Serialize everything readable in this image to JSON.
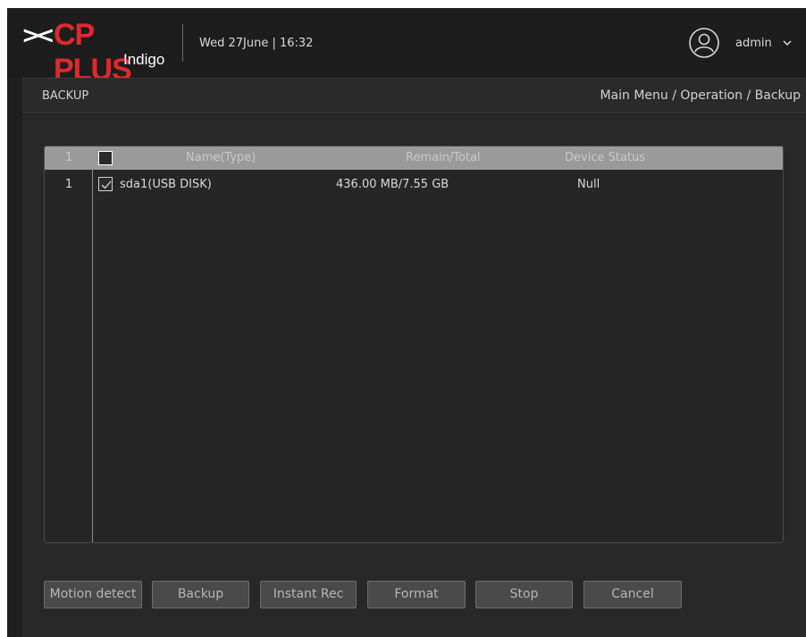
{
  "header": {
    "brand": "CP PLUS",
    "brand_sub": "Indigo",
    "datetime": "Wed 27June | 16:32",
    "user": "admin"
  },
  "titlebar": {
    "title": "BACKUP",
    "breadcrumb": "Main Menu / Operation / Backup"
  },
  "table": {
    "headers": {
      "index": "1",
      "name": "Name(Type)",
      "remain": "Remain/Total",
      "status": "Device Status"
    },
    "rows": [
      {
        "index": "1",
        "checked": true,
        "name": "sda1(USB DISK)",
        "remain": "436.00 MB/7.55 GB",
        "status": "Null"
      }
    ]
  },
  "buttons": {
    "motion_detect": "Motion detect",
    "backup": "Backup",
    "instant_rec": "Instant Rec",
    "format": "Format",
    "stop": "Stop",
    "cancel": "Cancel"
  },
  "colors": {
    "brand_red": "#e0282e",
    "background": "#1f1f1f",
    "header_row": "#9a9a9a",
    "button": "#4a4a4a"
  },
  "icons": [
    "logo-mark-icon",
    "user-avatar-icon",
    "chevron-down-icon",
    "checkbox-icon",
    "checkmark-icon"
  ]
}
